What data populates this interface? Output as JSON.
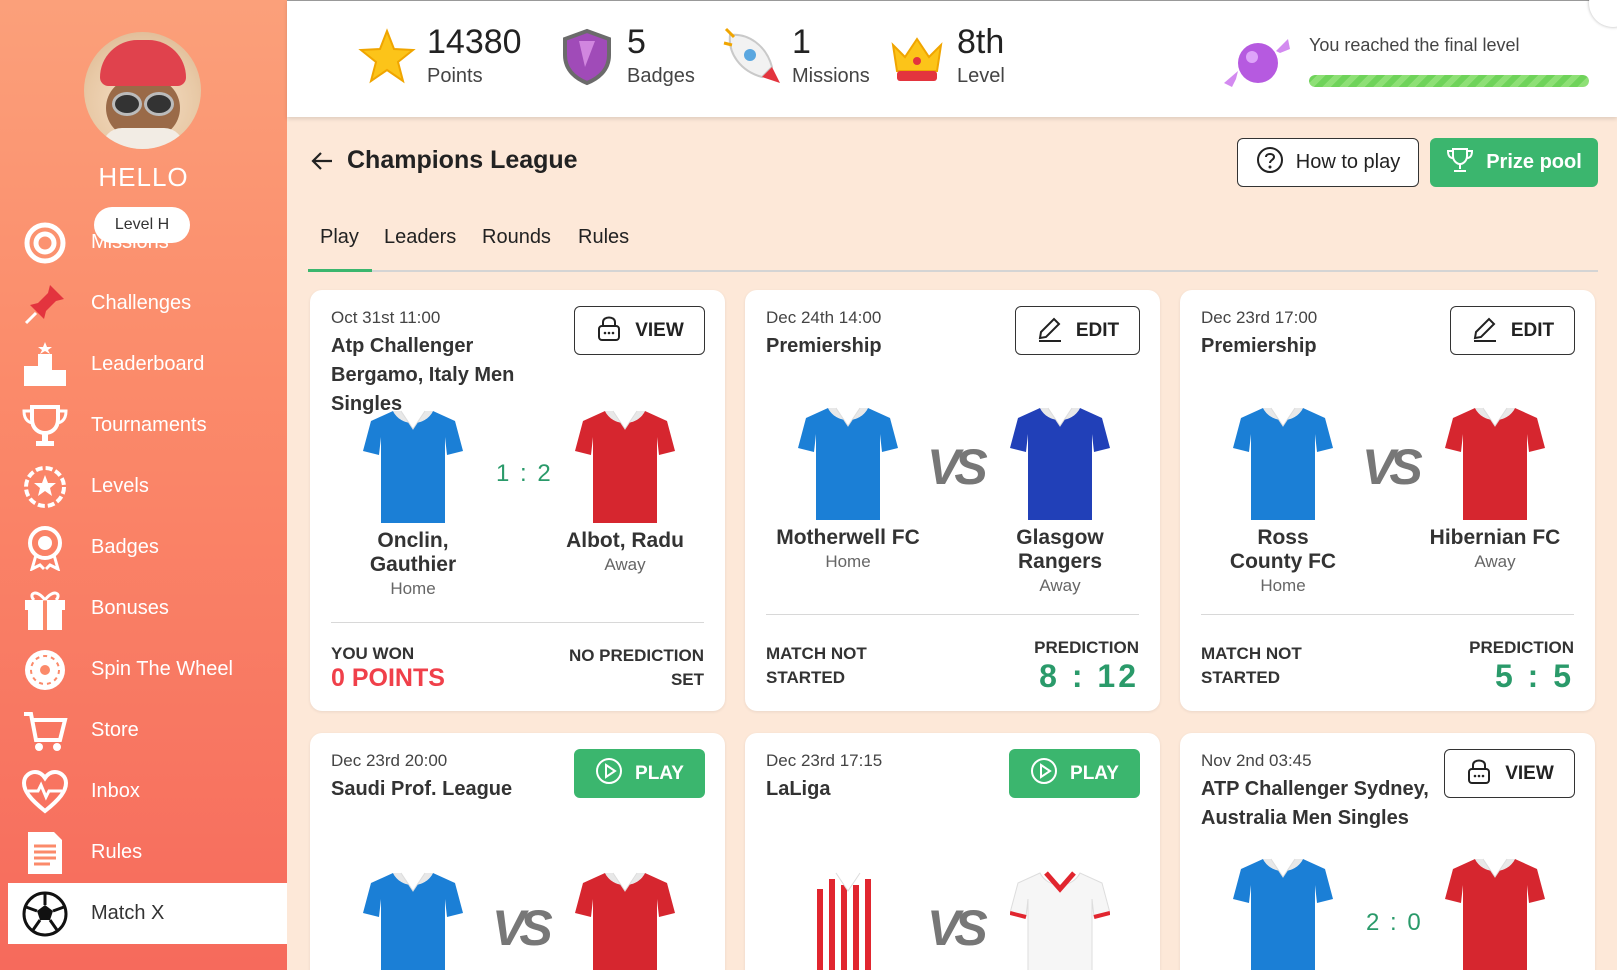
{
  "sidebar": {
    "greeting": "HELLO",
    "level": "Level H",
    "items": [
      {
        "label": "Missions",
        "icon": "target-icon"
      },
      {
        "label": "Challenges",
        "icon": "pin-icon"
      },
      {
        "label": "Leaderboard",
        "icon": "podium-icon"
      },
      {
        "label": "Tournaments",
        "icon": "trophy-icon"
      },
      {
        "label": "Levels",
        "icon": "star-gear-icon"
      },
      {
        "label": "Badges",
        "icon": "badge-icon"
      },
      {
        "label": "Bonuses",
        "icon": "gift-icon"
      },
      {
        "label": "Spin The Wheel",
        "icon": "wheel-icon"
      },
      {
        "label": "Store",
        "icon": "cart-icon"
      },
      {
        "label": "Inbox",
        "icon": "heart-pulse-icon"
      },
      {
        "label": "Rules",
        "icon": "document-icon"
      },
      {
        "label": "Match X",
        "icon": "soccer-ball-icon"
      }
    ]
  },
  "stats": {
    "points": {
      "value": "14380",
      "label": "Points"
    },
    "badges": {
      "value": "5",
      "label": "Badges"
    },
    "missions": {
      "value": "1",
      "label": "Missions"
    },
    "level": {
      "value": "8th",
      "label": "Level"
    },
    "final_text": "You reached the final level",
    "final_progress": 1.0
  },
  "header": {
    "title": "Champions League",
    "how_to_play": "How to play",
    "prize_pool": "Prize pool"
  },
  "tabs": [
    "Play",
    "Leaders",
    "Rounds",
    "Rules"
  ],
  "matches": [
    {
      "date": "Oct 31st 11:00",
      "league": "Atp Challenger Bergamo, Italy Men Singles",
      "action": "VIEW",
      "home": {
        "name": "Onclin, Gauthier",
        "role": "Home"
      },
      "away": {
        "name": "Albot, Radu",
        "role": "Away"
      },
      "score": "1 : 2",
      "left_label": "YOU WON",
      "left_value": "0 POINTS",
      "right_label": "NO PREDICTION SET"
    },
    {
      "date": "Dec 24th 14:00",
      "league": "Premiership",
      "action": "EDIT",
      "home": {
        "name": "Motherwell FC",
        "role": "Home"
      },
      "away": {
        "name": "Glasgow Rangers",
        "role": "Away"
      },
      "vs": "VS",
      "left_label": "MATCH NOT STARTED",
      "right_label": "PREDICTION",
      "right_value": "8 : 12"
    },
    {
      "date": "Dec 23rd 17:00",
      "league": "Premiership",
      "action": "EDIT",
      "home": {
        "name": "Ross County FC",
        "role": "Home"
      },
      "away": {
        "name": "Hibernian FC",
        "role": "Away"
      },
      "vs": "VS",
      "left_label": "MATCH NOT STARTED",
      "right_label": "PREDICTION",
      "right_value": "5 : 5"
    },
    {
      "date": "Dec 23rd 20:00",
      "league": "Saudi Prof. League",
      "action": "PLAY",
      "vs": "VS"
    },
    {
      "date": "Dec 23rd 17:15",
      "league": "LaLiga",
      "action": "PLAY",
      "vs": "VS"
    },
    {
      "date": "Nov 2nd 03:45",
      "league": "ATP Challenger Sydney, Australia Men Singles",
      "action": "VIEW",
      "score": "2 : 0"
    }
  ],
  "colors": {
    "accent_green": "#3bb66e",
    "score_green": "#2a9a6a",
    "loss_red": "#f0404a",
    "sidebar_top": "#fba07a",
    "sidebar_bottom": "#f66a5c"
  }
}
